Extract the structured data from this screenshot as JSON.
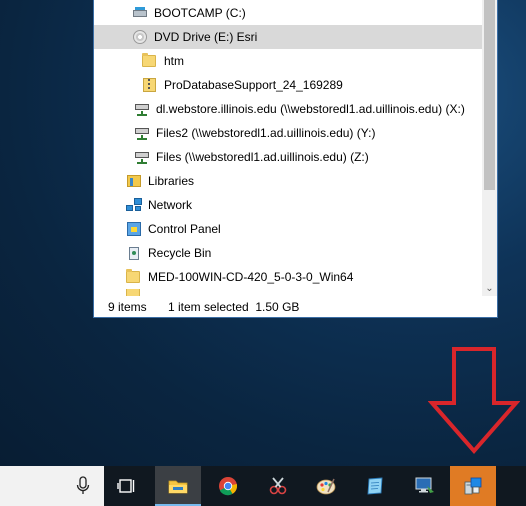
{
  "explorer": {
    "tree_items": [
      {
        "label": "BOOTCAMP (C:)",
        "icon": "local-drive-icon",
        "selected": false
      },
      {
        "label": "DVD Drive (E:) Esri",
        "icon": "dvd-drive-icon",
        "selected": true
      },
      {
        "label": "htm",
        "icon": "folder-icon",
        "selected": false
      },
      {
        "label": "ProDatabaseSupport_24_169289",
        "icon": "zip-folder-icon",
        "selected": false
      },
      {
        "label": "dl.webstore.illinois.edu (\\\\webstoredl1.ad.uillinois.edu) (X:)",
        "icon": "network-drive-icon",
        "selected": false
      },
      {
        "label": "Files2 (\\\\webstoredl1.ad.uillinois.edu) (Y:)",
        "icon": "network-drive-icon",
        "selected": false
      },
      {
        "label": "Files (\\\\webstoredl1.ad.uillinois.edu) (Z:)",
        "icon": "network-drive-icon",
        "selected": false
      },
      {
        "label": "Libraries",
        "icon": "libraries-icon",
        "selected": false
      },
      {
        "label": "Network",
        "icon": "network-icon",
        "selected": false
      },
      {
        "label": "Control Panel",
        "icon": "control-panel-icon",
        "selected": false
      },
      {
        "label": "Recycle Bin",
        "icon": "recycle-bin-icon",
        "selected": false
      },
      {
        "label": "MED-100WIN-CD-420_5-0-3-0_Win64",
        "icon": "folder-icon",
        "selected": false
      }
    ],
    "status": {
      "item_count": "9 items",
      "selection": "1 item selected  1.50 GB"
    }
  },
  "taskbar": {
    "buttons": [
      {
        "name": "microphone-icon"
      },
      {
        "name": "task-view-icon"
      },
      {
        "name": "file-explorer-icon",
        "state": "active"
      },
      {
        "name": "chrome-icon"
      },
      {
        "name": "snipping-tool-icon"
      },
      {
        "name": "paint-icon"
      },
      {
        "name": "notepad-icon"
      },
      {
        "name": "remote-desktop-icon"
      },
      {
        "name": "installer-icon",
        "state": "highlighted"
      }
    ]
  },
  "colors": {
    "selected_row": "#d9d9d9",
    "arrow": "#d9262b",
    "taskbar": "#101820",
    "highlight_button": "#e07b24",
    "active_underline": "#76b9ed"
  }
}
